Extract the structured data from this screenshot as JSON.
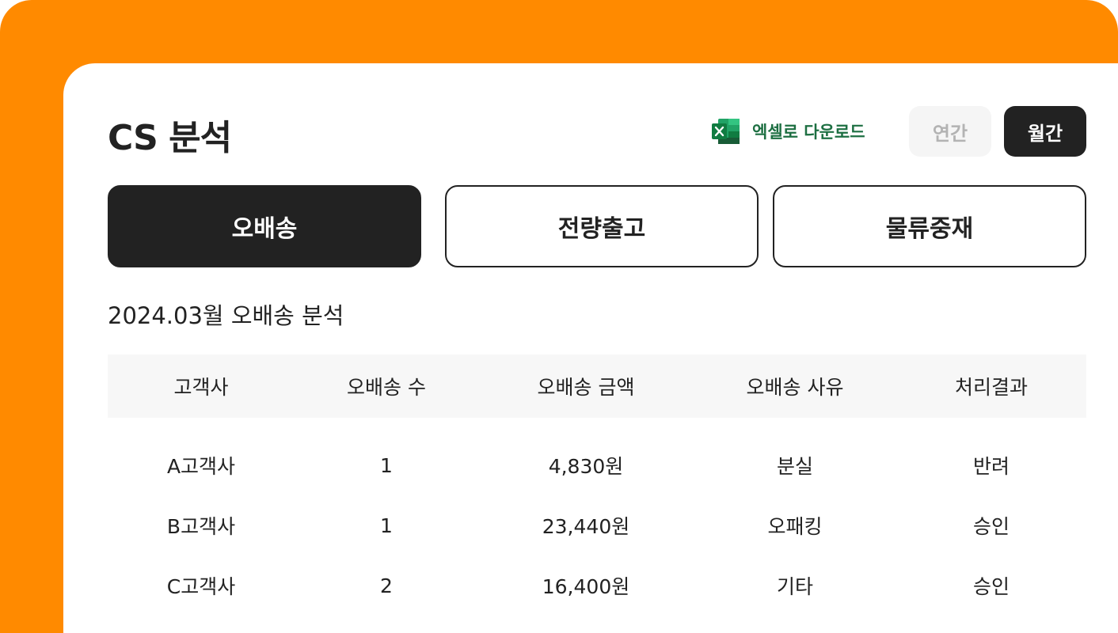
{
  "page_title": "CS 분석",
  "excel_download": {
    "label": "엑셀로 다운로드",
    "icon": "excel-icon"
  },
  "period_toggle": {
    "yearly": "연간",
    "monthly": "월간",
    "selected": "월간"
  },
  "tabs": [
    {
      "label": "오배송",
      "active": true
    },
    {
      "label": "전량출고",
      "active": false
    },
    {
      "label": "물류중재",
      "active": false
    }
  ],
  "section_title": "2024.03월 오배송 분석",
  "table": {
    "headers": [
      "고객사",
      "오배송 수",
      "오배송 금액",
      "오배송 사유",
      "처리결과"
    ],
    "rows": [
      [
        "A고객사",
        "1",
        "4,830원",
        "분실",
        "반려"
      ],
      [
        "B고객사",
        "1",
        "23,440원",
        "오패킹",
        "승인"
      ],
      [
        "C고객사",
        "2",
        "16,400원",
        "기타",
        "승인"
      ]
    ]
  },
  "colors": {
    "brand_orange": "#ff8a00",
    "dark": "#222222",
    "excel_green": "#1d6f42",
    "header_bg": "#f7f7f7"
  }
}
